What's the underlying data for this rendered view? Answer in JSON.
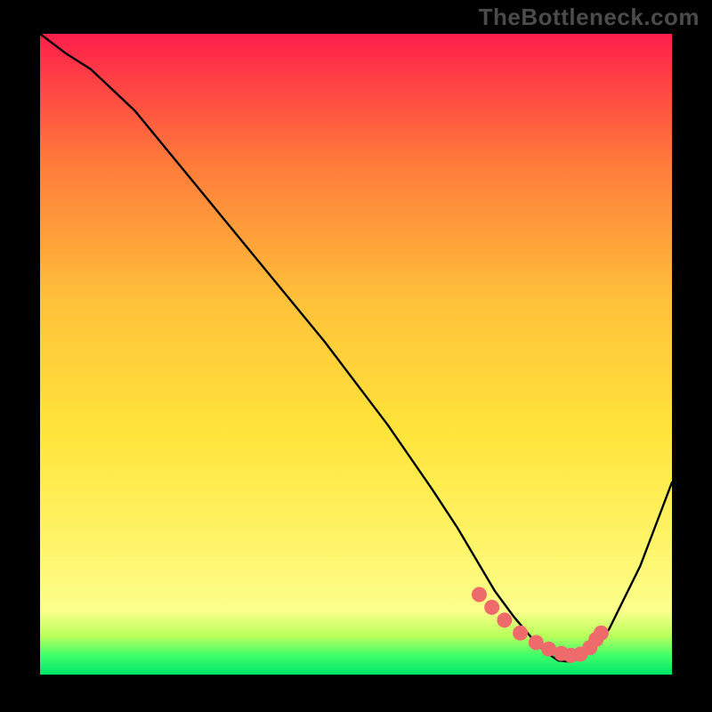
{
  "watermark": "TheBottleneck.com",
  "colors": {
    "frame_bg": "#000000",
    "grad_top": "#ff1f4b",
    "grad_mid1": "#ff7a3a",
    "grad_mid2": "#ffc23a",
    "grad_mid3": "#ffe43a",
    "grad_mid4": "#fff56a",
    "grad_bottom_yellow": "#fbff8c",
    "grad_green1": "#b8ff5a",
    "grad_green2": "#3fff6a",
    "grad_green3": "#00e56a",
    "curve": "#000000",
    "dot_fill": "#ef6a6a",
    "dot_stroke": "#b13a3a"
  },
  "chart_data": {
    "type": "line",
    "title": "",
    "xlabel": "",
    "ylabel": "",
    "xlim": [
      0,
      100
    ],
    "ylim": [
      0,
      100
    ],
    "series": [
      {
        "name": "bottleneck-curve",
        "x": [
          0,
          4,
          8,
          15,
          25,
          35,
          45,
          55,
          62,
          66,
          69,
          72,
          75,
          78,
          80,
          82,
          84,
          86,
          90,
          95,
          100
        ],
        "y": [
          100,
          97,
          94.5,
          88,
          76,
          64,
          52,
          39,
          29,
          23,
          18,
          13,
          9,
          5.5,
          3.5,
          2.2,
          2.0,
          2.8,
          7,
          17,
          30
        ]
      }
    ],
    "dots": {
      "name": "highlight-dots",
      "x": [
        69.5,
        71.5,
        73.5,
        76,
        78.5,
        80.5,
        82.5,
        84,
        85.5,
        87,
        88,
        88.8
      ],
      "y": [
        12.5,
        10.5,
        8.5,
        6.5,
        5.0,
        4.0,
        3.3,
        3.0,
        3.2,
        4.2,
        5.5,
        6.5
      ]
    }
  }
}
